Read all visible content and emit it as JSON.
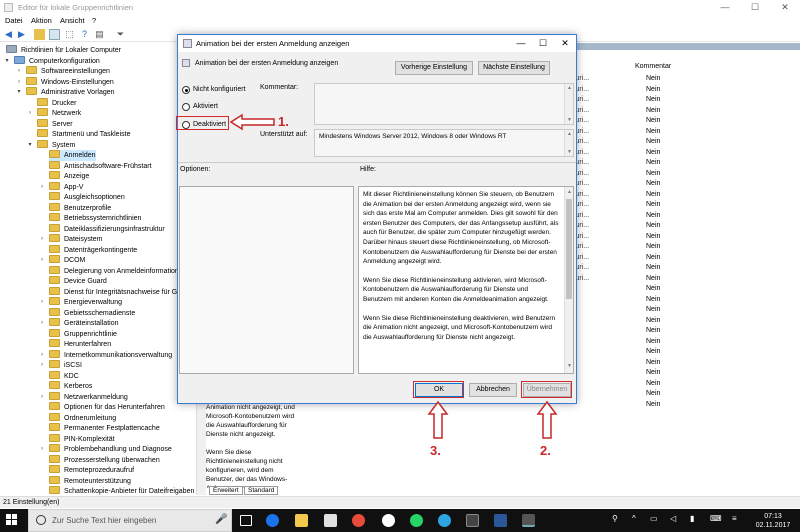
{
  "window": {
    "title": "Editor für lokale Gruppenrichtlinien",
    "minimize": "—",
    "maximize": "☐",
    "close": "✕"
  },
  "menu": [
    "Datei",
    "Aktion",
    "Ansicht",
    "?"
  ],
  "tree": {
    "items": [
      {
        "label": "Richtlinien für Lokaler Computer",
        "level": 0,
        "exp": ""
      },
      {
        "label": "Computerkonfiguration",
        "level": 1,
        "exp": "▾"
      },
      {
        "label": "Softwareeinstellungen",
        "level": 2,
        "exp": "›"
      },
      {
        "label": "Windows-Einstellungen",
        "level": 2,
        "exp": "›"
      },
      {
        "label": "Administrative Vorlagen",
        "level": 2,
        "exp": "▾"
      },
      {
        "label": "Drucker",
        "level": 3,
        "exp": ""
      },
      {
        "label": "Netzwerk",
        "level": 3,
        "exp": "›"
      },
      {
        "label": "Server",
        "level": 3,
        "exp": ""
      },
      {
        "label": "Startmenü und Taskleiste",
        "level": 3,
        "exp": ""
      },
      {
        "label": "System",
        "level": 3,
        "exp": "▾"
      },
      {
        "label": "Anmelden",
        "level": 4,
        "exp": "",
        "selected": true
      },
      {
        "label": "Antischadsoftware-Frühstart",
        "level": 4,
        "exp": ""
      },
      {
        "label": "Anzeige",
        "level": 4,
        "exp": ""
      },
      {
        "label": "App-V",
        "level": 4,
        "exp": "›"
      },
      {
        "label": "Ausgleichsoptionen",
        "level": 4,
        "exp": ""
      },
      {
        "label": "Benutzerprofile",
        "level": 4,
        "exp": ""
      },
      {
        "label": "Betriebssystemrichtlinien",
        "level": 4,
        "exp": ""
      },
      {
        "label": "Dateiklassifizierungsinfrastruktur",
        "level": 4,
        "exp": ""
      },
      {
        "label": "Dateisystem",
        "level": 4,
        "exp": "›"
      },
      {
        "label": "Datenträgerkontingente",
        "level": 4,
        "exp": ""
      },
      {
        "label": "DCOM",
        "level": 4,
        "exp": "›"
      },
      {
        "label": "Delegierung von Anmeldeinformation",
        "level": 4,
        "exp": ""
      },
      {
        "label": "Device Guard",
        "level": 4,
        "exp": ""
      },
      {
        "label": "Dienst für Integritätsnachweise für Ger",
        "level": 4,
        "exp": ""
      },
      {
        "label": "Energieverwaltung",
        "level": 4,
        "exp": "›"
      },
      {
        "label": "Gebietsschemadienste",
        "level": 4,
        "exp": ""
      },
      {
        "label": "Geräteinstallation",
        "level": 4,
        "exp": "›"
      },
      {
        "label": "Gruppenrichtlinie",
        "level": 4,
        "exp": ""
      },
      {
        "label": "Herunterfahren",
        "level": 4,
        "exp": ""
      },
      {
        "label": "Internetkommunikationsverwaltung",
        "level": 4,
        "exp": "›"
      },
      {
        "label": "iSCSI",
        "level": 4,
        "exp": "›"
      },
      {
        "label": "KDC",
        "level": 4,
        "exp": ""
      },
      {
        "label": "Kerberos",
        "level": 4,
        "exp": ""
      },
      {
        "label": "Netzwerkanmeldung",
        "level": 4,
        "exp": "›"
      },
      {
        "label": "Optionen für das Herunterfahren",
        "level": 4,
        "exp": ""
      },
      {
        "label": "Ordnerumleitung",
        "level": 4,
        "exp": ""
      },
      {
        "label": "Permanenter Festplattencache",
        "level": 4,
        "exp": ""
      },
      {
        "label": "PIN-Komplexität",
        "level": 4,
        "exp": ""
      },
      {
        "label": "Problembehandlung und Diagnose",
        "level": 4,
        "exp": "›"
      },
      {
        "label": "Prozesserstellung überwachen",
        "level": 4,
        "exp": ""
      },
      {
        "label": "Remoteprozeduraufruf",
        "level": 4,
        "exp": ""
      },
      {
        "label": "Remoteunterstützung",
        "level": 4,
        "exp": ""
      },
      {
        "label": "Schattenkopie-Anbieter für Dateifreigaben",
        "level": 4,
        "exp": ""
      }
    ]
  },
  "rightpane": {
    "header": "Kommentar",
    "rows": [
      "Nein",
      "Nein",
      "Nein",
      "Nein",
      "Nein",
      "Nein",
      "Nein",
      "Nein",
      "Nein",
      "Nein",
      "Nein",
      "Nein",
      "Nein",
      "Nein",
      "Nein",
      "Nein",
      "Nein",
      "Nein",
      "Nein",
      "Nein",
      "Nein",
      "Nein",
      "Nein",
      "Nein",
      "Nein",
      "Nein",
      "Nein",
      "Nein",
      "Nein",
      "Nein",
      "Nein",
      "Nein"
    ],
    "partial": "suri..."
  },
  "description": {
    "text": "Animation nicht angezeigt, und Microsoft-Kontobenutzern wird die Auswahlaufforderung für Dienste nicht angezeigt.",
    "text2": "Wenn Sie diese Richtlinieneinstellung nicht konfigurieren, wird dem Benutzer, der das Windows-Anfangssetup",
    "tab_extended": "Erweitert",
    "tab_standard": "Standard"
  },
  "status": "21 Einstellung(en)",
  "dialog": {
    "title": "Animation bei der ersten Anmeldung anzeigen",
    "setting_name": "Animation bei der ersten Anmeldung anzeigen",
    "prev_button": "Vorherige Einstellung",
    "next_button": "Nächste Einstellung",
    "radio_not_configured": "Nicht konfiguriert",
    "radio_enabled": "Aktiviert",
    "radio_disabled": "Deaktiviert",
    "comment_label": "Kommentar:",
    "supported_label": "Unterstützt auf:",
    "supported_value": "Mindestens Windows Server 2012, Windows 8 oder Windows RT",
    "options_label": "Optionen:",
    "help_label": "Hilfe:",
    "help_paragraphs": [
      "Mit dieser Richtlinieneinstellung können Sie steuern, ob Benutzern die Animation bei der ersten Anmeldung angezeigt wird, wenn sie sich das erste Mal am Computer anmelden. Dies gilt sowohl für den ersten Benutzer des Computers, der das Anfangssetup ausführt, als auch für Benutzer, die später zum Computer hinzugefügt werden. Darüber hinaus steuert diese Richtlinieneinstellung, ob Microsoft-Kontobenutzern die Auswahlaufforderung für Dienste bei der ersten Anmeldung angezeigt wird.",
      "Wenn Sie diese Richtlinieneinstellung aktivieren, wird Microsoft-Kontobenutzern die Auswahlaufforderung für Dienste und Benutzern mit anderen Konten die Anmeldeanimation angezeigt.",
      "Wenn Sie diese Richtlinieneinstellung deaktivieren, wird Benutzern die Animation nicht angezeigt, und Microsoft-Kontobenutzern wird die Auswahlaufforderung für Dienste nicht angezeigt."
    ],
    "ok": "OK",
    "cancel": "Abbrechen",
    "apply": "Übernehmen"
  },
  "annotations": {
    "step1": "1.",
    "step2": "2.",
    "step3": "3.",
    "color": "#c62828"
  },
  "taskbar": {
    "search_placeholder": "Zur Suche Text hier eingeben",
    "time": "07:13",
    "date": "02.11.2017"
  }
}
